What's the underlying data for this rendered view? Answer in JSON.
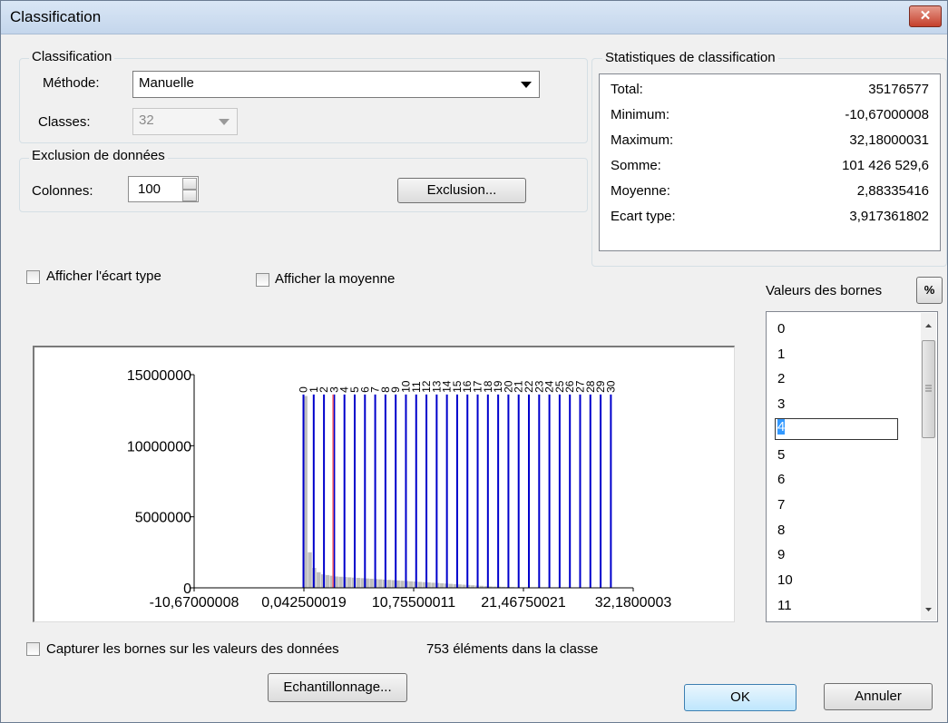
{
  "window": {
    "title": "Classification",
    "close_symbol": "✕"
  },
  "classification": {
    "group_title": "Classification",
    "method_label": "Méthode:",
    "method_value": "Manuelle",
    "classes_label": "Classes:",
    "classes_value": "32"
  },
  "exclusion": {
    "group_title": "Exclusion de données",
    "columns_label": "Colonnes:",
    "columns_value": "100",
    "button_label": "Exclusion..."
  },
  "stats": {
    "group_title": "Statistiques de classification",
    "rows": [
      {
        "label": "Total:",
        "value": "35176577"
      },
      {
        "label": "Minimum:",
        "value": "-10,67000008"
      },
      {
        "label": "Maximum:",
        "value": "32,18000031"
      },
      {
        "label": "Somme:",
        "value": "101 426 529,6"
      },
      {
        "label": "Moyenne:",
        "value": "2,88335416"
      },
      {
        "label": "Ecart type:",
        "value": "3,917361802"
      }
    ]
  },
  "options": {
    "show_std_label": "Afficher l'écart type",
    "show_mean_label": "Afficher la moyenne"
  },
  "breaks": {
    "label": "Valeurs des bornes",
    "percent_button": "%",
    "items": [
      "0",
      "1",
      "2",
      "3",
      "4",
      "5",
      "6",
      "7",
      "8",
      "9",
      "10",
      "11"
    ],
    "selected_index": 4
  },
  "chart_data": {
    "type": "bar",
    "y_ticks": [
      "15000000",
      "10000000",
      "5000000",
      "0"
    ],
    "x_ticks": [
      "-10,67000008",
      "0,042500019",
      "10,75500011",
      "21,46750021",
      "32,1800003"
    ],
    "y_range": [
      0,
      15000000
    ],
    "x_range": [
      -10.67000008,
      32.18000031
    ],
    "break_values": [
      0,
      1,
      2,
      3,
      4,
      5,
      6,
      7,
      8,
      9,
      10,
      11,
      12,
      13,
      14,
      15,
      16,
      17,
      18,
      19,
      20,
      21,
      22,
      23,
      24,
      25,
      26,
      27,
      28,
      29,
      30
    ],
    "break_labels_top": [
      "0",
      "1",
      "2",
      "3",
      "4",
      "5",
      "6",
      "7",
      "8",
      "9",
      "10",
      "11",
      "12",
      "13",
      "14",
      "15",
      "16",
      "17",
      "18",
      "19",
      "20",
      "21",
      "22",
      "23",
      "24",
      "25",
      "26",
      "27",
      "28",
      "29",
      "30"
    ],
    "mean_value": 2.88335416,
    "histogram": [
      {
        "x": 0.0,
        "count": 13500000
      },
      {
        "x": 0.43,
        "count": 2500000
      },
      {
        "x": 0.86,
        "count": 1400000
      },
      {
        "x": 1.29,
        "count": 1100000
      },
      {
        "x": 1.72,
        "count": 950000
      },
      {
        "x": 2.15,
        "count": 900000
      },
      {
        "x": 2.58,
        "count": 850000
      },
      {
        "x": 3.01,
        "count": 800000
      },
      {
        "x": 3.44,
        "count": 780000
      },
      {
        "x": 3.87,
        "count": 760000
      },
      {
        "x": 4.3,
        "count": 740000
      },
      {
        "x": 4.73,
        "count": 720000
      },
      {
        "x": 5.16,
        "count": 700000
      },
      {
        "x": 5.59,
        "count": 680000
      },
      {
        "x": 6.02,
        "count": 660000
      },
      {
        "x": 6.45,
        "count": 640000
      },
      {
        "x": 6.88,
        "count": 620000
      },
      {
        "x": 7.31,
        "count": 600000
      },
      {
        "x": 7.74,
        "count": 580000
      },
      {
        "x": 8.17,
        "count": 560000
      },
      {
        "x": 8.6,
        "count": 540000
      },
      {
        "x": 9.03,
        "count": 520000
      },
      {
        "x": 9.46,
        "count": 500000
      },
      {
        "x": 9.89,
        "count": 480000
      },
      {
        "x": 10.32,
        "count": 460000
      },
      {
        "x": 10.75,
        "count": 440000
      },
      {
        "x": 11.18,
        "count": 420000
      },
      {
        "x": 11.61,
        "count": 400000
      },
      {
        "x": 12.04,
        "count": 380000
      },
      {
        "x": 12.47,
        "count": 360000
      },
      {
        "x": 12.9,
        "count": 340000
      },
      {
        "x": 13.33,
        "count": 320000
      },
      {
        "x": 13.76,
        "count": 300000
      },
      {
        "x": 14.19,
        "count": 280000
      },
      {
        "x": 14.62,
        "count": 260000
      },
      {
        "x": 15.05,
        "count": 240000
      },
      {
        "x": 15.48,
        "count": 220000
      },
      {
        "x": 15.91,
        "count": 200000
      },
      {
        "x": 16.34,
        "count": 180000
      },
      {
        "x": 16.77,
        "count": 160000
      },
      {
        "x": 17.2,
        "count": 140000
      },
      {
        "x": 17.63,
        "count": 120000
      },
      {
        "x": 18.06,
        "count": 100000
      },
      {
        "x": 18.49,
        "count": 90000
      },
      {
        "x": 18.92,
        "count": 80000
      },
      {
        "x": 19.35,
        "count": 70000
      },
      {
        "x": 19.78,
        "count": 60000
      },
      {
        "x": 20.21,
        "count": 50000
      }
    ],
    "colors": {
      "break_line": "#0000cc",
      "mean_line": "#ff6666",
      "histogram": "#bfbfbf"
    }
  },
  "footer": {
    "snap_label": "Capturer les bornes sur les valeurs des données",
    "count_text": "753 éléments dans la classe",
    "sampling_button": "Echantillonnage...",
    "ok_button": "OK",
    "cancel_button": "Annuler"
  }
}
